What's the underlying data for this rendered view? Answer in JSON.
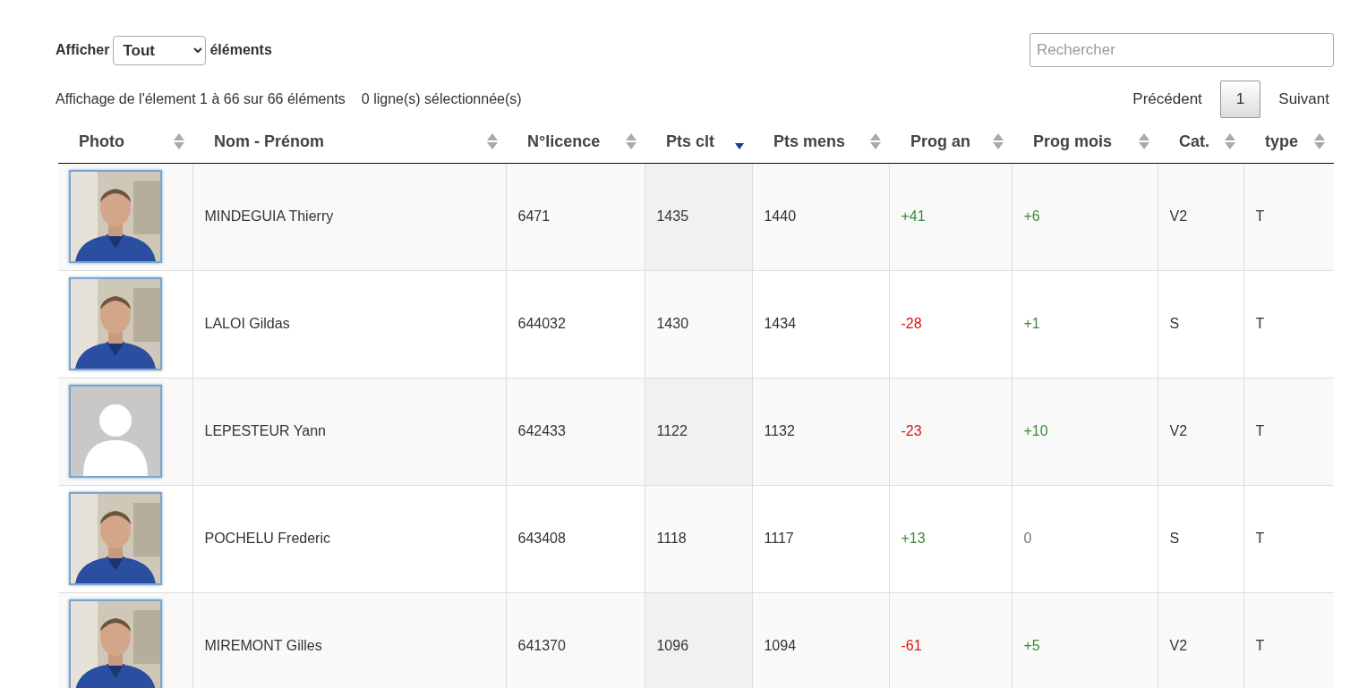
{
  "length_menu": {
    "label_before": "Afficher",
    "value": "Tout",
    "label_after": "éléments"
  },
  "search": {
    "placeholder": "Rechercher"
  },
  "info": {
    "range": "Affichage de l'élement 1 à 66 sur 66 éléments",
    "selection": "0 ligne(s) sélectionnée(s)"
  },
  "pagination": {
    "previous": "Précédent",
    "pages": [
      {
        "label": "1",
        "selected": true
      }
    ],
    "next": "Suivant"
  },
  "table": {
    "columns": [
      {
        "label": "Photo",
        "sorted": false
      },
      {
        "label": "Nom - Prénom",
        "sorted": false
      },
      {
        "label": "N°licence",
        "sorted": false
      },
      {
        "label": "Pts clt",
        "sorted": true
      },
      {
        "label": "Pts mens",
        "sorted": false
      },
      {
        "label": "Prog an",
        "sorted": false
      },
      {
        "label": "Prog mois",
        "sorted": false
      },
      {
        "label": "Cat.",
        "sorted": false
      },
      {
        "label": "type",
        "sorted": false
      }
    ],
    "rows": [
      {
        "name": "MINDEGUIA Thierry",
        "licence": "6471",
        "pts_clt": "1435",
        "pts_mens": "1440",
        "prog_an": {
          "text": "+41",
          "color": "#3c8a3c"
        },
        "prog_mois": {
          "text": "+6",
          "color": "#3c8a3c"
        },
        "cat": "V2",
        "type": "T"
      },
      {
        "name": "LALOI Gildas",
        "licence": "644032",
        "pts_clt": "1430",
        "pts_mens": "1434",
        "prog_an": {
          "text": "-28",
          "color": "#e01010"
        },
        "prog_mois": {
          "text": "+1",
          "color": "#3c8a3c"
        },
        "cat": "S",
        "type": "T"
      },
      {
        "photo": {
          "kind": "avatar"
        },
        "name": "LEPESTEUR Yann",
        "licence": "642433",
        "pts_clt": "1122",
        "pts_mens": "1132",
        "prog_an": {
          "text": "-23",
          "color": "#e01010"
        },
        "prog_mois": {
          "text": "+10",
          "color": "#3c8a3c"
        },
        "cat": "V2",
        "type": "T"
      },
      {
        "name": "POCHELU Frederic",
        "licence": "643408",
        "pts_clt": "1118",
        "pts_mens": "1117",
        "prog_an": {
          "text": "+13",
          "color": "#3c8a3c"
        },
        "prog_mois": {
          "text": "0",
          "color": "#777777"
        },
        "cat": "S",
        "type": "T"
      },
      {
        "name": "MIREMONT Gilles",
        "licence": "641370",
        "pts_clt": "1096",
        "pts_mens": "1094",
        "prog_an": {
          "text": "-61",
          "color": "#e01010"
        },
        "prog_mois": {
          "text": "+5",
          "color": "#3c8a3c"
        },
        "cat": "V2",
        "type": "T"
      }
    ]
  }
}
